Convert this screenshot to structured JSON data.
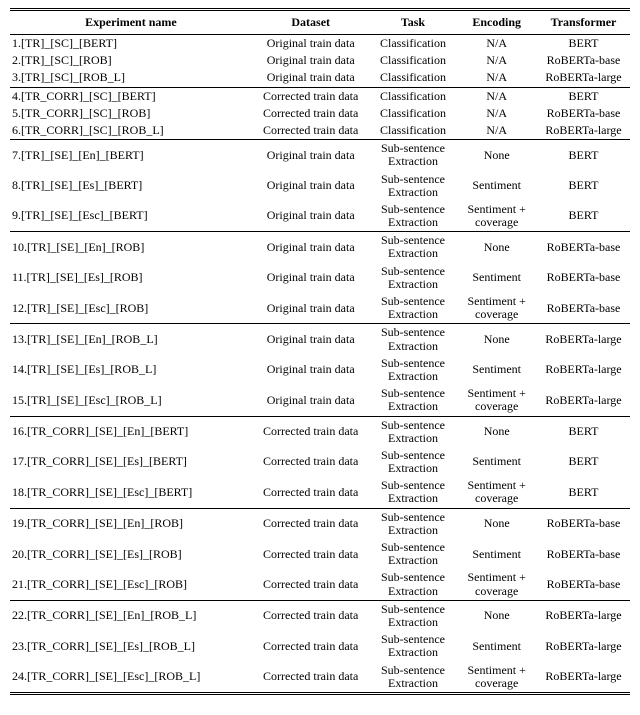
{
  "headers": [
    "Experiment name",
    "Dataset",
    "Task",
    "Encoding",
    "Transformer"
  ],
  "groups": [
    {
      "rows": [
        {
          "exp": "1.[TR]_[SC]_[BERT]",
          "dataset": "Original train data",
          "task": "Classification",
          "encoding": "N/A",
          "transformer": "BERT"
        },
        {
          "exp": "2.[TR]_[SC]_[ROB]",
          "dataset": "Original train data",
          "task": "Classification",
          "encoding": "N/A",
          "transformer": "RoBERTa-base"
        },
        {
          "exp": "3.[TR]_[SC]_[ROB_L]",
          "dataset": "Original train data",
          "task": "Classification",
          "encoding": "N/A",
          "transformer": "RoBERTa-large"
        }
      ]
    },
    {
      "rows": [
        {
          "exp": "4.[TR_CORR]_[SC]_[BERT]",
          "dataset": "Corrected train data",
          "task": "Classification",
          "encoding": "N/A",
          "transformer": "BERT"
        },
        {
          "exp": "5.[TR_CORR]_[SC]_[ROB]",
          "dataset": "Corrected train data",
          "task": "Classification",
          "encoding": "N/A",
          "transformer": "RoBERTa-base"
        },
        {
          "exp": "6.[TR_CORR]_[SC]_[ROB_L]",
          "dataset": "Corrected train data",
          "task": "Classification",
          "encoding": "N/A",
          "transformer": "RoBERTa-large"
        }
      ]
    },
    {
      "rows": [
        {
          "exp": "7.[TR]_[SE]_[En]_[BERT]",
          "dataset": "Original train data",
          "task": "Sub-sentence\nExtraction",
          "encoding": "None",
          "transformer": "BERT"
        },
        {
          "exp": "8.[TR]_[SE]_[Es]_[BERT]",
          "dataset": "Original train data",
          "task": "Sub-sentence\nExtraction",
          "encoding": "Sentiment",
          "transformer": "BERT"
        },
        {
          "exp": "9.[TR]_[SE]_[Esc]_[BERT]",
          "dataset": "Original train data",
          "task": "Sub-sentence\nExtraction",
          "encoding": "Sentiment +\ncoverage",
          "transformer": "BERT"
        }
      ]
    },
    {
      "rows": [
        {
          "exp": "10.[TR]_[SE]_[En]_[ROB]",
          "dataset": "Original train data",
          "task": "Sub-sentence\nExtraction",
          "encoding": "None",
          "transformer": "RoBERTa-base"
        },
        {
          "exp": "11.[TR]_[SE]_[Es]_[ROB]",
          "dataset": "Original train data",
          "task": "Sub-sentence\nExtraction",
          "encoding": "Sentiment",
          "transformer": "RoBERTa-base"
        },
        {
          "exp": "12.[TR]_[SE]_[Esc]_[ROB]",
          "dataset": "Original train data",
          "task": "Sub-sentence\nExtraction",
          "encoding": "Sentiment +\ncoverage",
          "transformer": "RoBERTa-base"
        }
      ]
    },
    {
      "rows": [
        {
          "exp": "13.[TR]_[SE]_[En]_[ROB_L]",
          "dataset": "Original train data",
          "task": "Sub-sentence\nExtraction",
          "encoding": "None",
          "transformer": "RoBERTa-large"
        },
        {
          "exp": "14.[TR]_[SE]_[Es]_[ROB_L]",
          "dataset": "Original train data",
          "task": "Sub-sentence\nExtraction",
          "encoding": "Sentiment",
          "transformer": "RoBERTa-large"
        },
        {
          "exp": "15.[TR]_[SE]_[Esc]_[ROB_L]",
          "dataset": "Original train data",
          "task": "Sub-sentence\nExtraction",
          "encoding": "Sentiment +\ncoverage",
          "transformer": "RoBERTa-large"
        }
      ]
    },
    {
      "rows": [
        {
          "exp": "16.[TR_CORR]_[SE]_[En]_[BERT]",
          "dataset": "Corrected train data",
          "task": "Sub-sentence\nExtraction",
          "encoding": "None",
          "transformer": "BERT"
        },
        {
          "exp": "17.[TR_CORR]_[SE]_[Es]_[BERT]",
          "dataset": "Corrected train data",
          "task": "Sub-sentence\nExtraction",
          "encoding": "Sentiment",
          "transformer": "BERT"
        },
        {
          "exp": "18.[TR_CORR]_[SE]_[Esc]_[BERT]",
          "dataset": "Corrected train data",
          "task": "Sub-sentence\nExtraction",
          "encoding": "Sentiment +\ncoverage",
          "transformer": "BERT"
        }
      ]
    },
    {
      "rows": [
        {
          "exp": "19.[TR_CORR]_[SE]_[En]_[ROB]",
          "dataset": "Corrected train data",
          "task": "Sub-sentence\nExtraction",
          "encoding": "None",
          "transformer": "RoBERTa-base"
        },
        {
          "exp": "20.[TR_CORR]_[SE]_[Es]_[ROB]",
          "dataset": "Corrected train data",
          "task": "Sub-sentence\nExtraction",
          "encoding": "Sentiment",
          "transformer": "RoBERTa-base"
        },
        {
          "exp": "21.[TR_CORR]_[SE]_[Esc]_[ROB]",
          "dataset": "Corrected train data",
          "task": "Sub-sentence\nExtraction",
          "encoding": "Sentiment +\ncoverage",
          "transformer": "RoBERTa-base"
        }
      ]
    },
    {
      "rows": [
        {
          "exp": "22.[TR_CORR]_[SE]_[En]_[ROB_L]",
          "dataset": "Corrected train data",
          "task": "Sub-sentence\nExtraction",
          "encoding": "None",
          "transformer": "RoBERTa-large"
        },
        {
          "exp": "23.[TR_CORR]_[SE]_[Es]_[ROB_L]",
          "dataset": "Corrected train data",
          "task": "Sub-sentence\nExtraction",
          "encoding": "Sentiment",
          "transformer": "RoBERTa-large"
        },
        {
          "exp": "24.[TR_CORR]_[SE]_[Esc]_[ROB_L]",
          "dataset": "Corrected train data",
          "task": "Sub-sentence\nExtraction",
          "encoding": "Sentiment +\ncoverage",
          "transformer": "RoBERTa-large"
        }
      ]
    }
  ]
}
